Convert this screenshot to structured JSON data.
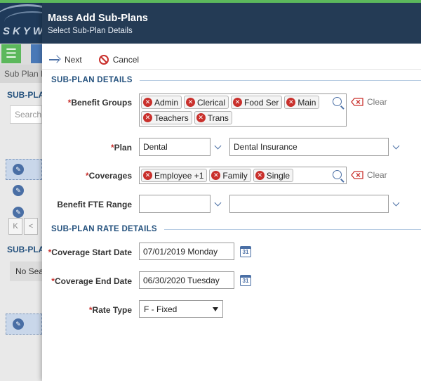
{
  "background": {
    "logo_text": "SKYWA",
    "menu_glyph": "☰",
    "breadcrumb": "Sub Plan L",
    "section1": "SUB-PLA",
    "search_placeholder": "Search",
    "section2": "SUB-PLA",
    "no_search": "No Sea",
    "pager_first": "K",
    "pager_prev": "<"
  },
  "modal": {
    "title": "Mass Add Sub-Plans",
    "subtitle": "Select Sub-Plan Details",
    "actions": {
      "next": "Next",
      "cancel": "Cancel"
    },
    "sections": {
      "details": "SUB-PLAN DETAILS",
      "rates": "SUB-PLAN RATE DETAILS"
    },
    "required_mark": "*",
    "clear_label": "Clear",
    "fields": {
      "benefit_groups": {
        "label": "Benefit Groups",
        "tags": [
          "Admin",
          "Clerical",
          "Food Ser",
          "Main",
          "Teachers",
          "Trans"
        ]
      },
      "plan": {
        "label": "Plan",
        "value": "Dental",
        "description": "Dental Insurance"
      },
      "coverages": {
        "label": "Coverages",
        "tags": [
          "Employee +1",
          "Family",
          "Single"
        ]
      },
      "fte_range": {
        "label": "Benefit FTE Range",
        "from": "",
        "to": ""
      },
      "coverage_start": {
        "label": "Coverage Start Date",
        "value": "07/01/2019 Monday"
      },
      "coverage_end": {
        "label": "Coverage End Date",
        "value": "06/30/2020 Tuesday"
      },
      "rate_type": {
        "label": "Rate Type",
        "value": "F - Fixed"
      }
    },
    "calendar_day": "31"
  },
  "colors": {
    "header_bg": "#243b55",
    "accent": "#4a6fa5",
    "section_title": "#25527e",
    "required": "#c9302c",
    "tag_remove": "#c9302c",
    "menu_green": "#5cb85c"
  }
}
